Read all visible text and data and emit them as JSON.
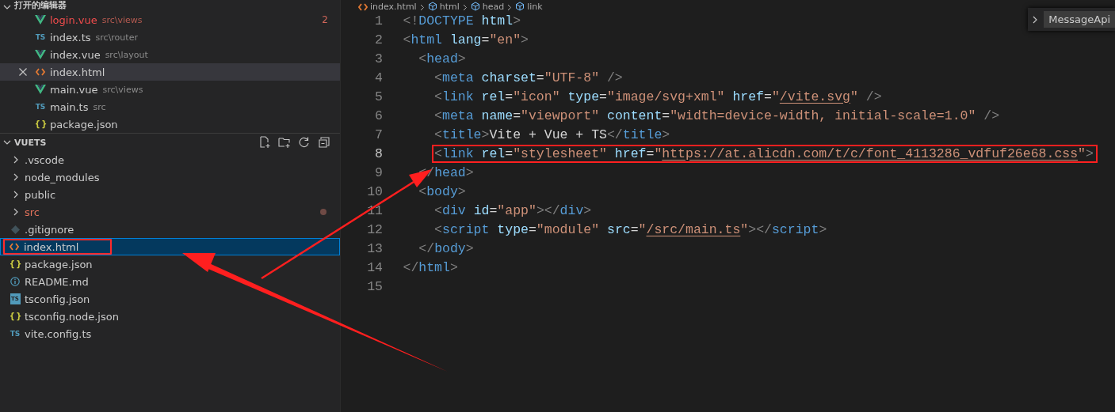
{
  "open_editors": {
    "title": "打开的编辑器",
    "expanded": true,
    "items": [
      {
        "name": "login.vue",
        "path": "src\\views",
        "kind": "vue",
        "error": true,
        "problems": "2",
        "selected": false
      },
      {
        "name": "index.ts",
        "path": "src\\router",
        "kind": "ts",
        "icon_label": "TS",
        "error": false,
        "selected": false
      },
      {
        "name": "index.vue",
        "path": "src\\layout",
        "kind": "vue",
        "error": false,
        "selected": false
      },
      {
        "name": "index.html",
        "kind": "html",
        "error": false,
        "selected": true
      },
      {
        "name": "main.vue",
        "path": "src\\views",
        "kind": "vue",
        "error": false,
        "selected": false
      },
      {
        "name": "main.ts",
        "path": "src",
        "kind": "ts",
        "icon_label": "TS",
        "error": false,
        "selected": false
      },
      {
        "name": "package.json",
        "kind": "json",
        "icon_label": "{ }",
        "error": false,
        "selected": false
      }
    ]
  },
  "explorer": {
    "title": "VUETS",
    "expanded": true,
    "items": [
      {
        "name": ".vscode",
        "kind": "folder",
        "expanded": false,
        "modified": false,
        "selected": false,
        "highlighted": false
      },
      {
        "name": "node_modules",
        "kind": "folder",
        "expanded": false,
        "modified": false,
        "selected": false,
        "highlighted": false
      },
      {
        "name": "public",
        "kind": "folder",
        "expanded": false,
        "modified": false,
        "selected": false,
        "highlighted": false
      },
      {
        "name": "src",
        "kind": "folder",
        "expanded": false,
        "modified": true,
        "selected": false,
        "highlighted": false
      },
      {
        "name": ".gitignore",
        "kind": "git",
        "modified": false,
        "selected": false,
        "highlighted": false
      },
      {
        "name": "index.html",
        "kind": "html",
        "modified": false,
        "selected": true,
        "highlighted": true
      },
      {
        "name": "package.json",
        "kind": "json",
        "icon_label": "{ }",
        "modified": false,
        "selected": false,
        "highlighted": false
      },
      {
        "name": "README.md",
        "kind": "info",
        "modified": false,
        "selected": false,
        "highlighted": false
      },
      {
        "name": "tsconfig.json",
        "kind": "tsconfig",
        "icon_label": "TS",
        "modified": false,
        "selected": false,
        "highlighted": false
      },
      {
        "name": "tsconfig.node.json",
        "kind": "json",
        "icon_label": "{ }",
        "modified": false,
        "selected": false,
        "highlighted": false
      },
      {
        "name": "vite.config.ts",
        "kind": "ts",
        "icon_label": "TS",
        "modified": false,
        "selected": false,
        "highlighted": false
      }
    ]
  },
  "breadcrumb": [
    {
      "label": "index.html",
      "kind": "html"
    },
    {
      "label": "html",
      "kind": "cube"
    },
    {
      "label": "head",
      "kind": "cube"
    },
    {
      "label": "link",
      "kind": "cube"
    }
  ],
  "lines": [
    {
      "number": "1",
      "active": false,
      "highlighted": false,
      "tokens": [
        {
          "text": "<!",
          "kind": "punctuation"
        },
        {
          "text": "DOCTYPE",
          "kind": "tag"
        },
        {
          "text": " html",
          "kind": "attribute"
        },
        {
          "text": ">",
          "kind": "punctuation"
        }
      ]
    },
    {
      "number": "2",
      "active": false,
      "highlighted": false,
      "tokens": [
        {
          "text": "<",
          "kind": "punctuation"
        },
        {
          "text": "html",
          "kind": "tag"
        },
        {
          "text": " lang",
          "kind": "attribute"
        },
        {
          "text": "=",
          "kind": "text"
        },
        {
          "text": "\"en\"",
          "kind": "string"
        },
        {
          "text": ">",
          "kind": "punctuation"
        }
      ]
    },
    {
      "number": "3",
      "active": false,
      "highlighted": false,
      "tokens": [
        {
          "text": "  <",
          "kind": "punctuation"
        },
        {
          "text": "head",
          "kind": "tag"
        },
        {
          "text": ">",
          "kind": "punctuation"
        }
      ]
    },
    {
      "number": "4",
      "active": false,
      "highlighted": false,
      "tokens": [
        {
          "text": "    <",
          "kind": "punctuation"
        },
        {
          "text": "meta",
          "kind": "tag"
        },
        {
          "text": " charset",
          "kind": "attribute"
        },
        {
          "text": "=",
          "kind": "text"
        },
        {
          "text": "\"UTF-8\"",
          "kind": "string"
        },
        {
          "text": " />",
          "kind": "punctuation"
        }
      ]
    },
    {
      "number": "5",
      "active": false,
      "highlighted": false,
      "tokens": [
        {
          "text": "    <",
          "kind": "punctuation"
        },
        {
          "text": "link",
          "kind": "tag"
        },
        {
          "text": " rel",
          "kind": "attribute"
        },
        {
          "text": "=",
          "kind": "text"
        },
        {
          "text": "\"icon\"",
          "kind": "string"
        },
        {
          "text": " type",
          "kind": "attribute"
        },
        {
          "text": "=",
          "kind": "text"
        },
        {
          "text": "\"image/svg+xml\"",
          "kind": "string"
        },
        {
          "text": " href",
          "kind": "attribute"
        },
        {
          "text": "=",
          "kind": "text"
        },
        {
          "text": "\"",
          "kind": "string"
        },
        {
          "text": "/vite.svg",
          "kind": "link"
        },
        {
          "text": "\"",
          "kind": "string"
        },
        {
          "text": " />",
          "kind": "punctuation"
        }
      ]
    },
    {
      "number": "6",
      "active": false,
      "highlighted": false,
      "tokens": [
        {
          "text": "    <",
          "kind": "punctuation"
        },
        {
          "text": "meta",
          "kind": "tag"
        },
        {
          "text": " name",
          "kind": "attribute"
        },
        {
          "text": "=",
          "kind": "text"
        },
        {
          "text": "\"viewport\"",
          "kind": "string"
        },
        {
          "text": " content",
          "kind": "attribute"
        },
        {
          "text": "=",
          "kind": "text"
        },
        {
          "text": "\"width=device-width, initial-scale=1.0\"",
          "kind": "string"
        },
        {
          "text": " />",
          "kind": "punctuation"
        }
      ]
    },
    {
      "number": "7",
      "active": false,
      "highlighted": false,
      "tokens": [
        {
          "text": "    <",
          "kind": "punctuation"
        },
        {
          "text": "title",
          "kind": "tag"
        },
        {
          "text": ">",
          "kind": "punctuation"
        },
        {
          "text": "Vite + Vue + TS",
          "kind": "text"
        },
        {
          "text": "</",
          "kind": "punctuation"
        },
        {
          "text": "title",
          "kind": "tag"
        },
        {
          "text": ">",
          "kind": "punctuation"
        }
      ]
    },
    {
      "number": "8",
      "active": true,
      "highlighted": true,
      "tokens": [
        {
          "text": "    <",
          "kind": "punctuation"
        },
        {
          "text": "link",
          "kind": "tag"
        },
        {
          "text": " rel",
          "kind": "attribute"
        },
        {
          "text": "=",
          "kind": "text"
        },
        {
          "text": "\"stylesheet\"",
          "kind": "string"
        },
        {
          "text": " href",
          "kind": "attribute"
        },
        {
          "text": "=",
          "kind": "text"
        },
        {
          "text": "\"",
          "kind": "string"
        },
        {
          "text": "https://at.alicdn.com/t/c/font_4113286_vdfuf26e68.css",
          "kind": "link"
        },
        {
          "text": "\"",
          "kind": "string"
        },
        {
          "text": ">",
          "kind": "punctuation"
        }
      ]
    },
    {
      "number": "9",
      "active": false,
      "highlighted": false,
      "tokens": [
        {
          "text": "  </",
          "kind": "punctuation"
        },
        {
          "text": "head",
          "kind": "tag"
        },
        {
          "text": ">",
          "kind": "punctuation"
        }
      ]
    },
    {
      "number": "10",
      "active": false,
      "highlighted": false,
      "tokens": [
        {
          "text": "  <",
          "kind": "punctuation"
        },
        {
          "text": "body",
          "kind": "tag"
        },
        {
          "text": ">",
          "kind": "punctuation"
        }
      ]
    },
    {
      "number": "11",
      "active": false,
      "highlighted": false,
      "tokens": [
        {
          "text": "    <",
          "kind": "punctuation"
        },
        {
          "text": "div",
          "kind": "tag"
        },
        {
          "text": " id",
          "kind": "attribute"
        },
        {
          "text": "=",
          "kind": "text"
        },
        {
          "text": "\"app\"",
          "kind": "string"
        },
        {
          "text": "></",
          "kind": "punctuation"
        },
        {
          "text": "div",
          "kind": "tag"
        },
        {
          "text": ">",
          "kind": "punctuation"
        }
      ]
    },
    {
      "number": "12",
      "active": false,
      "highlighted": false,
      "tokens": [
        {
          "text": "    <",
          "kind": "punctuation"
        },
        {
          "text": "script",
          "kind": "tag"
        },
        {
          "text": " type",
          "kind": "attribute"
        },
        {
          "text": "=",
          "kind": "text"
        },
        {
          "text": "\"module\"",
          "kind": "string"
        },
        {
          "text": " src",
          "kind": "attribute"
        },
        {
          "text": "=",
          "kind": "text"
        },
        {
          "text": "\"",
          "kind": "string"
        },
        {
          "text": "/src/main.ts",
          "kind": "link"
        },
        {
          "text": "\"",
          "kind": "string"
        },
        {
          "text": "></",
          "kind": "punctuation"
        },
        {
          "text": "script",
          "kind": "tag"
        },
        {
          "text": ">",
          "kind": "punctuation"
        }
      ]
    },
    {
      "number": "13",
      "active": false,
      "highlighted": false,
      "tokens": [
        {
          "text": "  </",
          "kind": "punctuation"
        },
        {
          "text": "body",
          "kind": "tag"
        },
        {
          "text": ">",
          "kind": "punctuation"
        }
      ]
    },
    {
      "number": "14",
      "active": false,
      "highlighted": false,
      "tokens": [
        {
          "text": "</",
          "kind": "punctuation"
        },
        {
          "text": "html",
          "kind": "tag"
        },
        {
          "text": ">",
          "kind": "punctuation"
        }
      ]
    },
    {
      "number": "15",
      "active": false
    }
  ],
  "sticky_widget": {
    "label": "MessageApi",
    "expanded": false
  }
}
